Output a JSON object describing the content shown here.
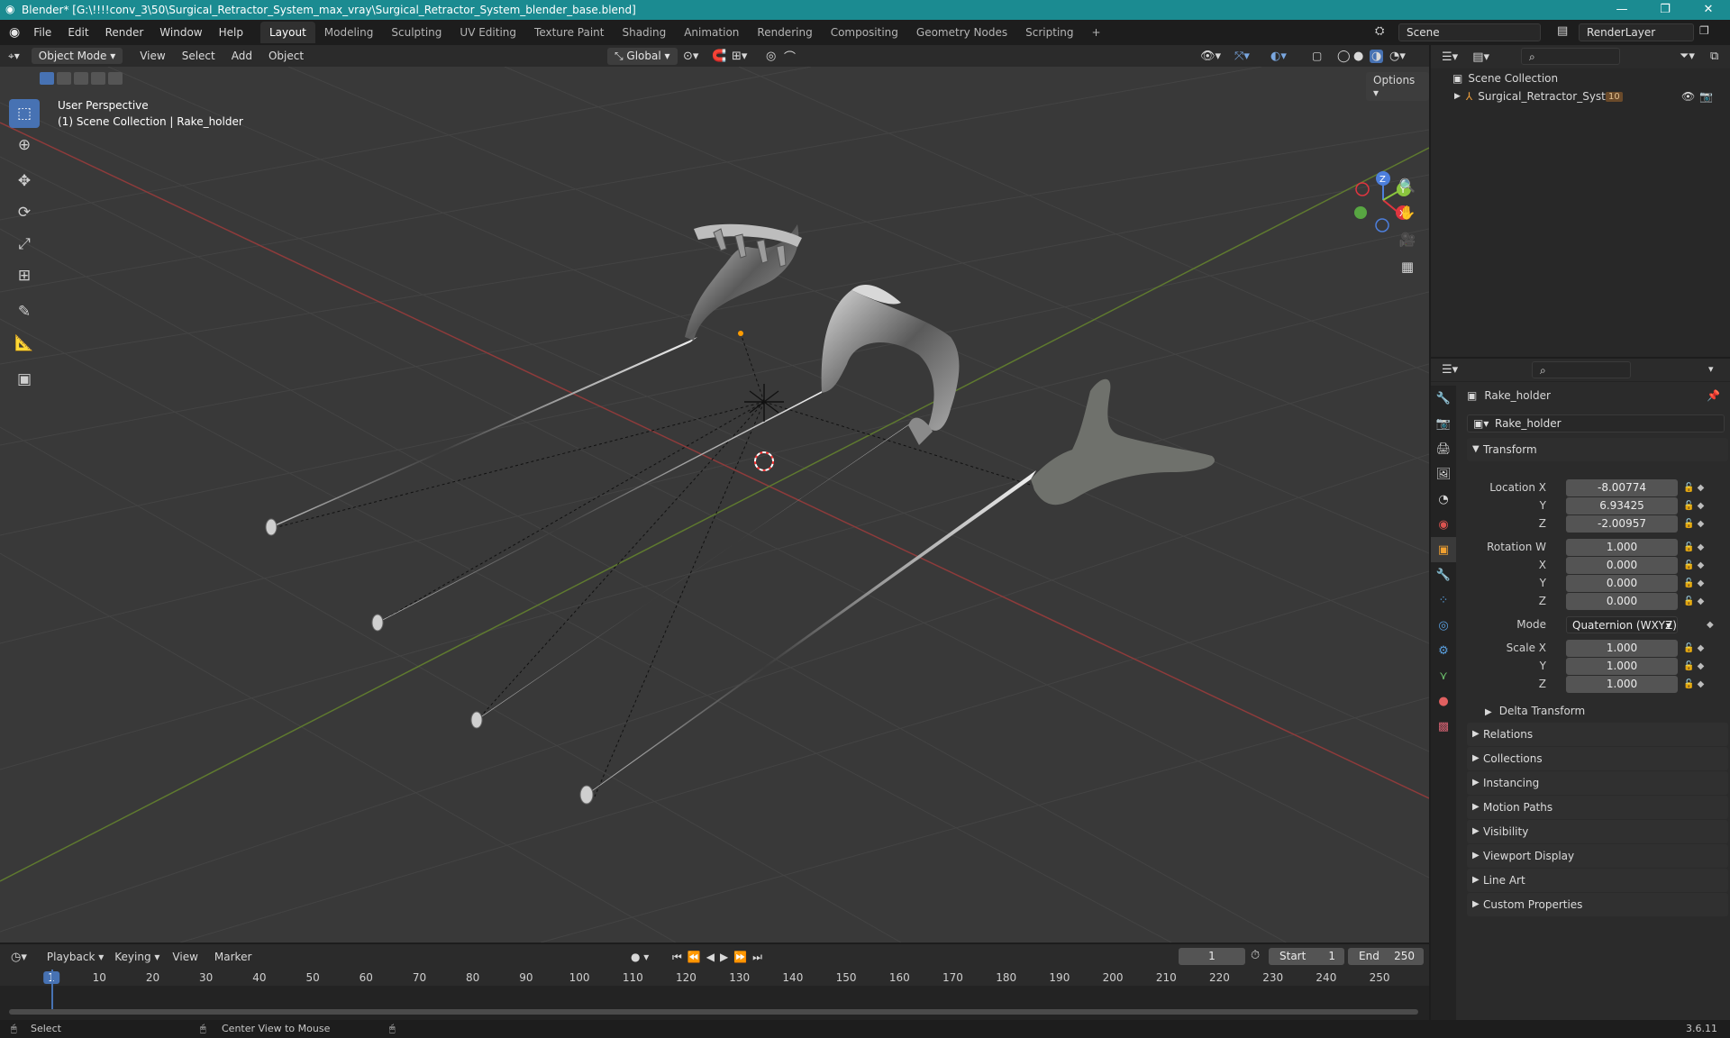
{
  "window": {
    "title": "Blender* [G:\\!!!!conv_3\\50\\Surgical_Retractor_System_max_vray\\Surgical_Retractor_System_blender_base.blend]",
    "controls": [
      "—",
      "❐",
      "✕"
    ]
  },
  "menu": [
    "File",
    "Edit",
    "Render",
    "Window",
    "Help"
  ],
  "workspaces": [
    "Layout",
    "Modeling",
    "Sculpting",
    "UV Editing",
    "Texture Paint",
    "Shading",
    "Animation",
    "Rendering",
    "Compositing",
    "Geometry Nodes",
    "Scripting"
  ],
  "active_workspace": "Layout",
  "scene": {
    "name": "Scene",
    "render_layer": "RenderLayer"
  },
  "viewport_header": {
    "mode": "Object Mode",
    "menus": [
      "View",
      "Select",
      "Add",
      "Object"
    ],
    "orientation": "Global",
    "options": "Options"
  },
  "viewport": {
    "perspective": "User Perspective",
    "collection_line": "(1) Scene Collection | Rake_holder",
    "gizmo": {
      "x": "X",
      "y": "Y",
      "z": "Z"
    }
  },
  "outliner": {
    "root": "Scene Collection",
    "items": [
      {
        "name": "Surgical_Retractor_System",
        "badge": "10"
      }
    ]
  },
  "properties": {
    "object_name": "Rake_holder",
    "data_name": "Rake_holder",
    "transform_title": "Transform",
    "location": {
      "label": "Location X",
      "x": "-8.00774",
      "y": "6.93425",
      "z": "-2.00957"
    },
    "rotation": {
      "label": "Rotation W",
      "w": "1.000",
      "x": "0.000",
      "y": "0.000",
      "z": "0.000"
    },
    "mode_label": "Mode",
    "mode_value": "Quaternion (WXYZ)",
    "scale": {
      "label": "Scale X",
      "x": "1.000",
      "y": "1.000",
      "z": "1.000"
    },
    "axis_labels": {
      "x": "X",
      "y": "Y",
      "z": "Z"
    },
    "delta": "Delta Transform",
    "sections": [
      "Relations",
      "Collections",
      "Instancing",
      "Motion Paths",
      "Visibility",
      "Viewport Display",
      "Line Art",
      "Custom Properties"
    ]
  },
  "timeline": {
    "menus": [
      "Playback",
      "Keying",
      "View",
      "Marker"
    ],
    "current_frame": "1",
    "start_label": "Start",
    "start": "1",
    "end_label": "End",
    "end": "250",
    "ticks": [
      "1",
      "10",
      "20",
      "30",
      "40",
      "50",
      "60",
      "70",
      "80",
      "90",
      "100",
      "110",
      "120",
      "130",
      "140",
      "150",
      "160",
      "170",
      "180",
      "190",
      "200",
      "210",
      "220",
      "230",
      "240",
      "250"
    ]
  },
  "status": {
    "left": "Select",
    "middle": "Center View to Mouse",
    "version": "3.6.11"
  }
}
